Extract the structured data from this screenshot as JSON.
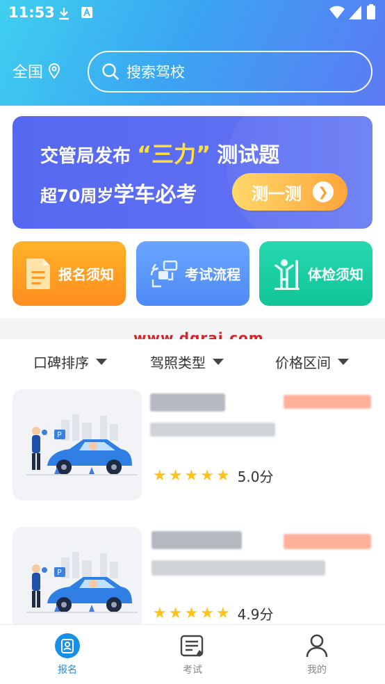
{
  "status_bar": {
    "time": "11:53"
  },
  "header": {
    "location": "全国",
    "search_placeholder": "搜索驾校"
  },
  "banner": {
    "line1_a": "交管局发布",
    "line1_hl": "“三力”",
    "line1_b": "测试题",
    "line2_a": "超70周岁",
    "line2_b": "学车必考",
    "button": "测一测"
  },
  "quick_actions": [
    {
      "label": "报名须知",
      "icon": "document-icon"
    },
    {
      "label": "考试流程",
      "icon": "flowchart-icon"
    },
    {
      "label": "体检须知",
      "icon": "fitness-person-icon"
    }
  ],
  "watermark": "www.dgrai.com",
  "filters": [
    {
      "label": "口碑排序"
    },
    {
      "label": "驾照类型"
    },
    {
      "label": "价格区间"
    }
  ],
  "schools": [
    {
      "score": "5.0分",
      "stars": 5
    },
    {
      "score": "4.9分",
      "stars": 5
    }
  ],
  "tabs": [
    {
      "label": "报名",
      "active": true
    },
    {
      "label": "考试",
      "active": false
    },
    {
      "label": "我的",
      "active": false
    }
  ],
  "colors": {
    "accent": "#1a8fe6",
    "banner_bg": "#5668f0",
    "star": "#ffc21a"
  }
}
